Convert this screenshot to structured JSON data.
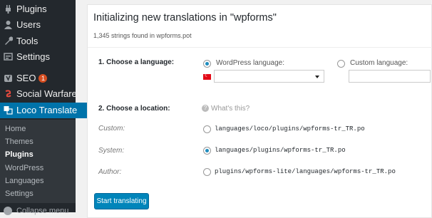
{
  "sidebar": {
    "items": [
      {
        "label": "Plugins",
        "icon": "plugins-icon"
      },
      {
        "label": "Users",
        "icon": "users-icon"
      },
      {
        "label": "Tools",
        "icon": "tools-icon"
      },
      {
        "label": "Settings",
        "icon": "settings-icon"
      },
      {
        "label": "SEO",
        "icon": "yoast-icon",
        "badge": "1"
      },
      {
        "label": "Social Warfare",
        "icon": "social-warfare-icon"
      },
      {
        "label": "Loco Translate",
        "icon": "loco-translate-icon"
      }
    ],
    "submenu": [
      "Home",
      "Themes",
      "Plugins",
      "WordPress",
      "Languages",
      "Settings"
    ],
    "collapse_label": "Collapse menu"
  },
  "panel": {
    "title": "Initializing new translations in \"wpforms\"",
    "subtitle": "1,345 strings found in wpforms.pot",
    "step1": {
      "label": "1. Choose a language:",
      "wp_language_label": "WordPress language:",
      "custom_language_label": "Custom language:",
      "selected_language": ""
    },
    "step2": {
      "label": "2. Choose a location:",
      "help": "What's this?",
      "locations": [
        {
          "label": "Custom:",
          "path": "languages/loco/plugins/wpforms-tr_TR.po",
          "checked": false
        },
        {
          "label": "System:",
          "path": "languages/plugins/wpforms-tr_TR.po",
          "checked": true
        },
        {
          "label": "Author:",
          "path": "plugins/wpforms-lite/languages/wpforms-tr_TR.po",
          "checked": false
        }
      ]
    },
    "button": "Start translating"
  }
}
